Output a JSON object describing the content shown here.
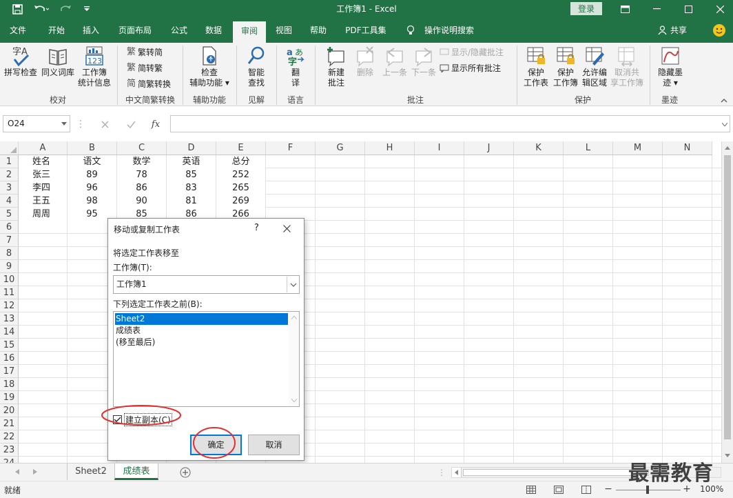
{
  "window": {
    "title": "工作簿1  -  Excel",
    "login": "登录"
  },
  "tabs": [
    "文件",
    "开始",
    "插入",
    "页面布局",
    "公式",
    "数据",
    "审阅",
    "视图",
    "帮助",
    "PDF工具集"
  ],
  "tell_me": "操作说明搜索",
  "share": "共享",
  "ribbon": {
    "spell": "拼写检查",
    "thesaurus": "同义词库",
    "stats1": "工作簿",
    "stats2": "统计信息",
    "trad_simp": "繁转简",
    "simp_trad": "简转繁",
    "conv": "简繁转换",
    "check1": "检查",
    "check2": "辅助功能",
    "smart1": "智能",
    "smart2": "查找",
    "translate1": "翻",
    "translate2": "译",
    "new_comment1": "新建",
    "new_comment2": "批注",
    "delete": "删除",
    "prev": "上一条",
    "next": "下一条",
    "show_hide": "显示/隐藏批注",
    "show_all": "显示所有批注",
    "protect_sheet1": "保护",
    "protect_sheet2": "工作表",
    "protect_wb1": "保护",
    "protect_wb2": "工作簿",
    "allow1": "允许编",
    "allow2": "辑区域",
    "unshare1": "取消共",
    "unshare2": "享工作簿",
    "ink1": "隐藏墨",
    "ink2": "迹",
    "groups": [
      "校对",
      "中文简繁转换",
      "辅助功能",
      "见解",
      "语言",
      "批注",
      "保护",
      "墨迹"
    ]
  },
  "formula": {
    "name_box": "O24",
    "fx": "fx",
    "value": ""
  },
  "columns": [
    "A",
    "B",
    "C",
    "D",
    "E",
    "F",
    "G",
    "H",
    "I",
    "J",
    "K",
    "L",
    "M",
    "N"
  ],
  "rows": [
    "1",
    "2",
    "3",
    "4",
    "5",
    "6",
    "7",
    "8",
    "9",
    "10",
    "11",
    "12",
    "13",
    "14",
    "15",
    "16",
    "17",
    "18",
    "19",
    "20",
    "21",
    "22",
    "23",
    "24"
  ],
  "cells": [
    [
      "姓名",
      "语文",
      "数学",
      "英语",
      "总分"
    ],
    [
      "张三",
      "89",
      "78",
      "85",
      "252"
    ],
    [
      "李四",
      "96",
      "86",
      "83",
      "265"
    ],
    [
      "王五",
      "98",
      "90",
      "81",
      "269"
    ],
    [
      "周周",
      "95",
      "85",
      "86",
      "266"
    ]
  ],
  "dialog": {
    "title": "移动或复制工作表",
    "help": "?",
    "subtitle": "将选定工作表移至",
    "workbook_label": "工作簿(T):",
    "workbook_value": "工作簿1",
    "before_label": "下列选定工作表之前(B):",
    "sheets": [
      "Sheet2",
      "成绩表",
      "(移至最后)"
    ],
    "copy_label": "建立副本(C)",
    "copy_checked": true,
    "ok": "确定",
    "cancel": "取消"
  },
  "sheet_tabs": [
    "Sheet2",
    "成绩表"
  ],
  "status": {
    "ready": "就绪",
    "zoom": "100%"
  },
  "watermark": "最需教育",
  "colors": {
    "excel_green": "#217346",
    "select_blue": "#0078d7",
    "highlight_red": "#e03030"
  }
}
